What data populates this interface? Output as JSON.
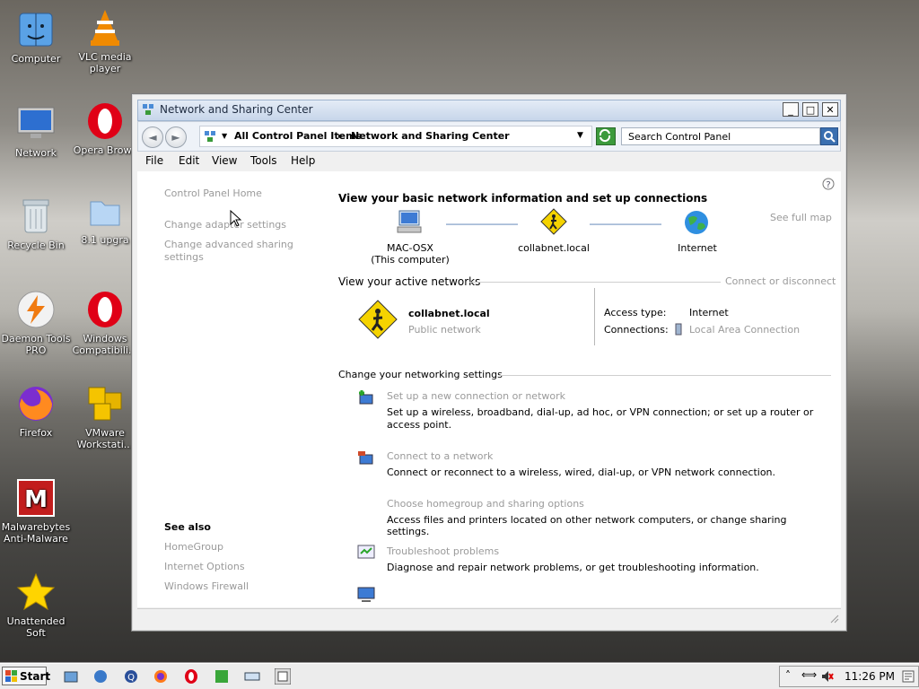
{
  "desktop": {
    "icons": [
      {
        "label": "Computer",
        "icon": "finder-icon"
      },
      {
        "label": "VLC media player",
        "icon": "vlc-icon"
      },
      {
        "label": "Network",
        "icon": "monitor-icon"
      },
      {
        "label": "Opera Brows",
        "icon": "opera-icon"
      },
      {
        "label": "Recycle Bin",
        "icon": "recycle-bin-icon"
      },
      {
        "label": "8.1 upgra",
        "icon": "folder-icon"
      },
      {
        "label": "Daemon Tools PRO",
        "icon": "daemon-tools-icon"
      },
      {
        "label": "Windows Compatibili...",
        "icon": "opera-icon"
      },
      {
        "label": "Firefox",
        "icon": "firefox-icon"
      },
      {
        "label": "VMware Workstati...",
        "icon": "vmware-icon"
      },
      {
        "label": "Malwarebytes Anti-Malware",
        "icon": "malwarebytes-icon"
      },
      {
        "label": "Unattended Soft",
        "icon": "star-icon"
      }
    ]
  },
  "window": {
    "title": "Network and Sharing Center",
    "breadcrumb": [
      "All Control Panel Items",
      "Network and Sharing Center"
    ],
    "search_placeholder": "Search Control Panel",
    "menu": [
      "File",
      "Edit",
      "View",
      "Tools",
      "Help"
    ]
  },
  "sidebar": {
    "home": "Control Panel Home",
    "links": [
      "Change adapter settings",
      "Change advanced sharing settings"
    ],
    "see_also_title": "See also",
    "see_also": [
      "HomeGroup",
      "Internet Options",
      "Windows Firewall"
    ]
  },
  "main": {
    "heading": "View your basic network information and set up connections",
    "see_full_map": "See full map",
    "nodes": [
      {
        "label": "MAC-OSX",
        "sub": "(This computer)"
      },
      {
        "label": "collabnet.local",
        "sub": ""
      },
      {
        "label": "Internet",
        "sub": ""
      }
    ],
    "active_title": "View your active networks",
    "connect_disconnect": "Connect or disconnect",
    "active_network": {
      "name": "collabnet.local",
      "type": "Public network",
      "access_type_label": "Access type:",
      "access_type_value": "Internet",
      "connections_label": "Connections:",
      "connections_value": "Local Area Connection"
    },
    "change_title": "Change your networking settings",
    "tasks": [
      {
        "title": "Set up a new connection or network",
        "desc": "Set up a wireless, broadband, dial-up, ad hoc, or VPN connection; or set up a router or access point."
      },
      {
        "title": "Connect to a network",
        "desc": "Connect or reconnect to a wireless, wired, dial-up, or VPN network connection."
      },
      {
        "title": "Choose homegroup and sharing options",
        "desc": "Access files and printers located on other network computers, or change sharing settings."
      },
      {
        "title": "Troubleshoot problems",
        "desc": "Diagnose and repair network problems, or get troubleshooting information."
      }
    ]
  },
  "taskbar": {
    "start": "Start",
    "clock": "11:26 PM"
  }
}
